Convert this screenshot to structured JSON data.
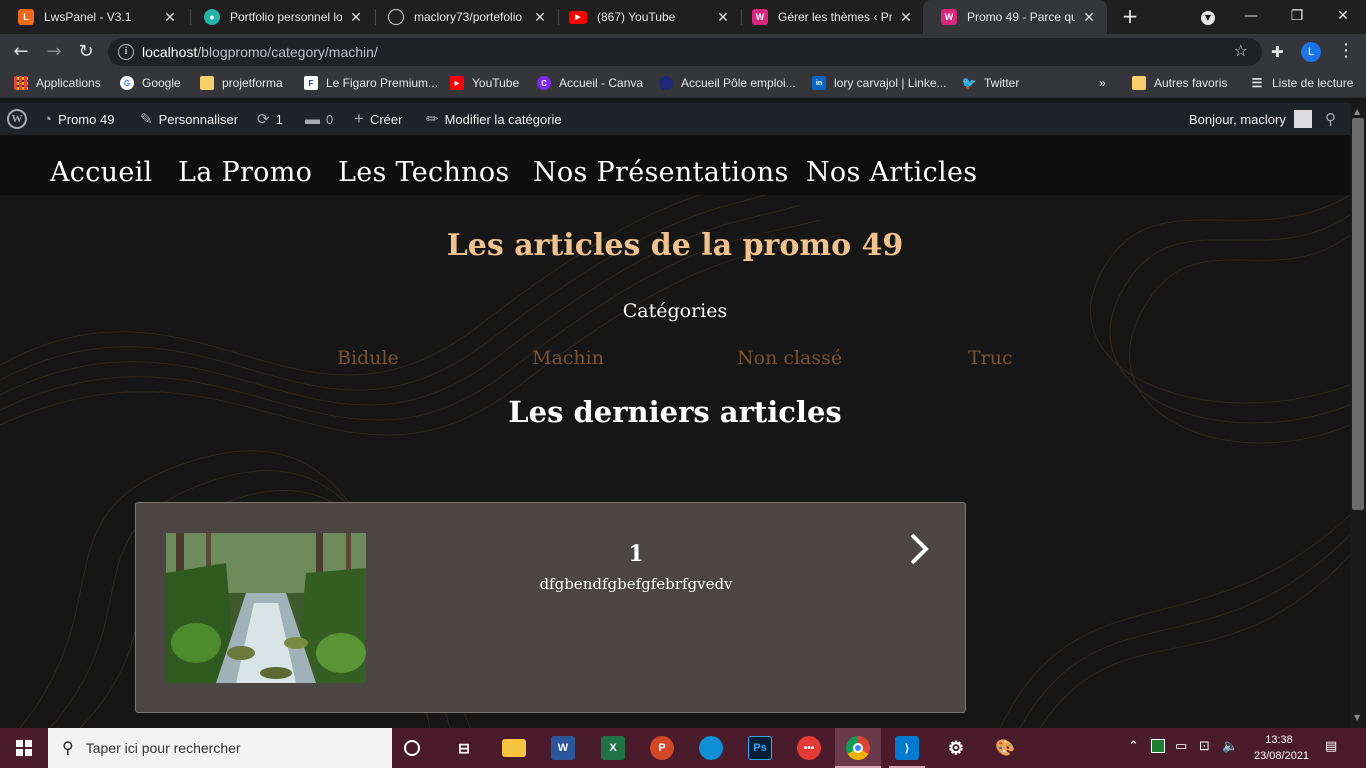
{
  "browser": {
    "tabs": [
      {
        "title": "LwsPanel - V3.1",
        "favicon_color": "#f06a1d",
        "favicon_glyph": "L"
      },
      {
        "title": "Portfolio personnel lor",
        "favicon_color": "#24b3a8",
        "favicon_glyph": "P"
      },
      {
        "title": "maclory73/portefolio",
        "favicon_color": "#333333",
        "favicon_glyph": "G"
      },
      {
        "title": "(867) YouTube",
        "favicon_color": "#ff0000",
        "favicon_glyph": "▶"
      },
      {
        "title": "Gérer les thèmes ‹ Pro",
        "favicon_color": "#d7287e",
        "favicon_glyph": "W"
      },
      {
        "title": "Promo 49 - Parce qu'o",
        "favicon_color": "#d7287e",
        "favicon_glyph": "W",
        "active": true
      }
    ],
    "url_host": "localhost",
    "url_path": "/blogpromo/category/machin/",
    "profile_initial": "L",
    "bookmarks": [
      {
        "label": "Applications",
        "icon": "apps-grid-icon",
        "color": "#e8a33d"
      },
      {
        "label": "Google",
        "icon": "google-icon",
        "color": "#4285f4"
      },
      {
        "label": "projetforma",
        "icon": "folder-icon",
        "color": "#f5cf6b"
      },
      {
        "label": "Le Figaro Premium...",
        "icon": "figaro-icon",
        "color": "#1e3a8a"
      },
      {
        "label": "YouTube",
        "icon": "youtube-icon",
        "color": "#ff0000"
      },
      {
        "label": "Accueil - Canva",
        "icon": "canva-icon",
        "color": "#7d2ae8"
      },
      {
        "label": "Accueil Pôle emploi...",
        "icon": "pole-emploi-icon",
        "color": "#1e2a78"
      },
      {
        "label": "lory carvajol | Linke...",
        "icon": "linkedin-icon",
        "color": "#0a66c2"
      },
      {
        "label": "Twitter",
        "icon": "twitter-icon",
        "color": "#1da1f2"
      }
    ],
    "bookmarks_more": "»",
    "other_favorites": "Autres favoris",
    "reading_list": "Liste de lecture"
  },
  "wp_admin_bar": {
    "site_name": "Promo 49",
    "customize": "Personnaliser",
    "updates_count": "1",
    "comments_count": "0",
    "new": "Créer",
    "edit": "Modifier la catégorie",
    "greeting": "Bonjour, maclory"
  },
  "site": {
    "nav": [
      "Accueil",
      "La Promo",
      "Les Technos",
      "Nos Présentations",
      "Nos Articles"
    ],
    "title": "Les articles de la promo 49",
    "categories_title": "Catégories",
    "categories": [
      "Bidule",
      "Machin",
      "Non classé",
      "Truc"
    ],
    "latest_title": "Les derniers articles",
    "articles": [
      {
        "title": "1",
        "excerpt": "dfgbendfgbefgfebrfgvedv"
      }
    ]
  },
  "taskbar": {
    "search_placeholder": "Taper ici pour rechercher",
    "time": "13:38",
    "date": "23/08/2021",
    "accent": "#4a1c2b"
  }
}
